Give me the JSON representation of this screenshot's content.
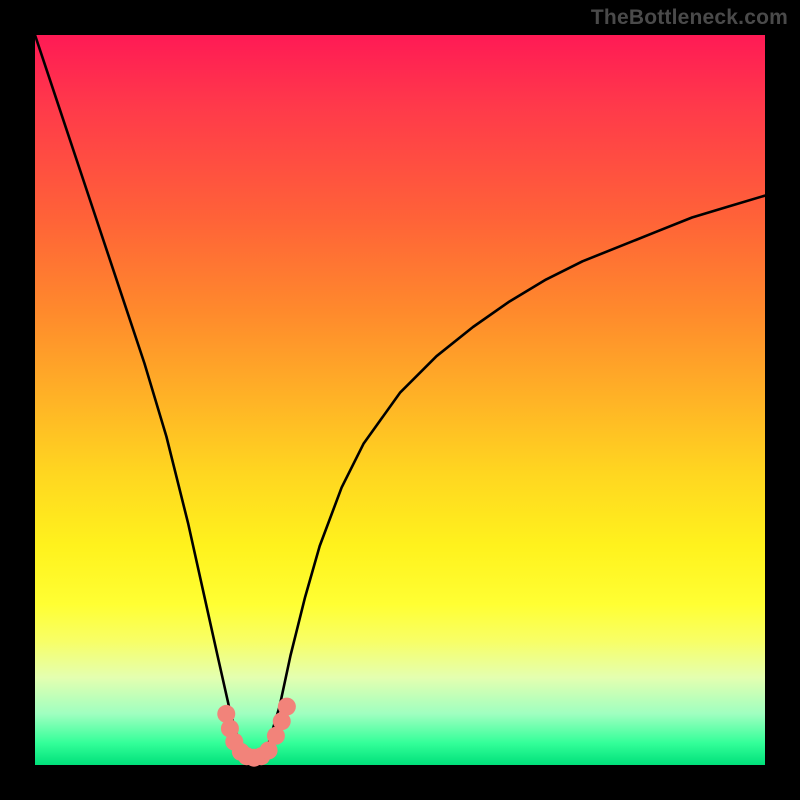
{
  "watermark": "TheBottleneck.com",
  "chart_data": {
    "type": "line",
    "title": "",
    "xlabel": "",
    "ylabel": "",
    "xlim": [
      0,
      100
    ],
    "ylim": [
      0,
      100
    ],
    "grid": false,
    "legend": false,
    "notes": "No visible axis ticks or numeric labels; a V-shaped black curve dips to the bottom around x≈30 then rises toward the right; a few salmon-colored marker dots cluster near the trough.",
    "series": [
      {
        "name": "curve",
        "color": "#000000",
        "x": [
          0,
          3,
          6,
          9,
          12,
          15,
          18,
          21,
          23,
          25,
          26.8,
          28,
          29.3,
          30.6,
          32,
          33.5,
          35,
          37,
          39,
          42,
          45,
          50,
          55,
          60,
          65,
          70,
          75,
          80,
          85,
          90,
          95,
          100
        ],
        "y": [
          100,
          91,
          82,
          73,
          64,
          55,
          45,
          33,
          24,
          15,
          7,
          3,
          1,
          1,
          3,
          8,
          15,
          23,
          30,
          38,
          44,
          51,
          56,
          60,
          63.5,
          66.5,
          69,
          71,
          73,
          75,
          76.5,
          78
        ]
      },
      {
        "name": "markers",
        "color": "#f2837a",
        "x": [
          26.2,
          26.7,
          27.3,
          28.2,
          29.0,
          30.0,
          31.0,
          32.0,
          33.0,
          33.8,
          34.5
        ],
        "y": [
          7.0,
          5.0,
          3.2,
          1.8,
          1.2,
          1.0,
          1.2,
          2.0,
          4.0,
          6.0,
          8.0
        ]
      }
    ]
  }
}
